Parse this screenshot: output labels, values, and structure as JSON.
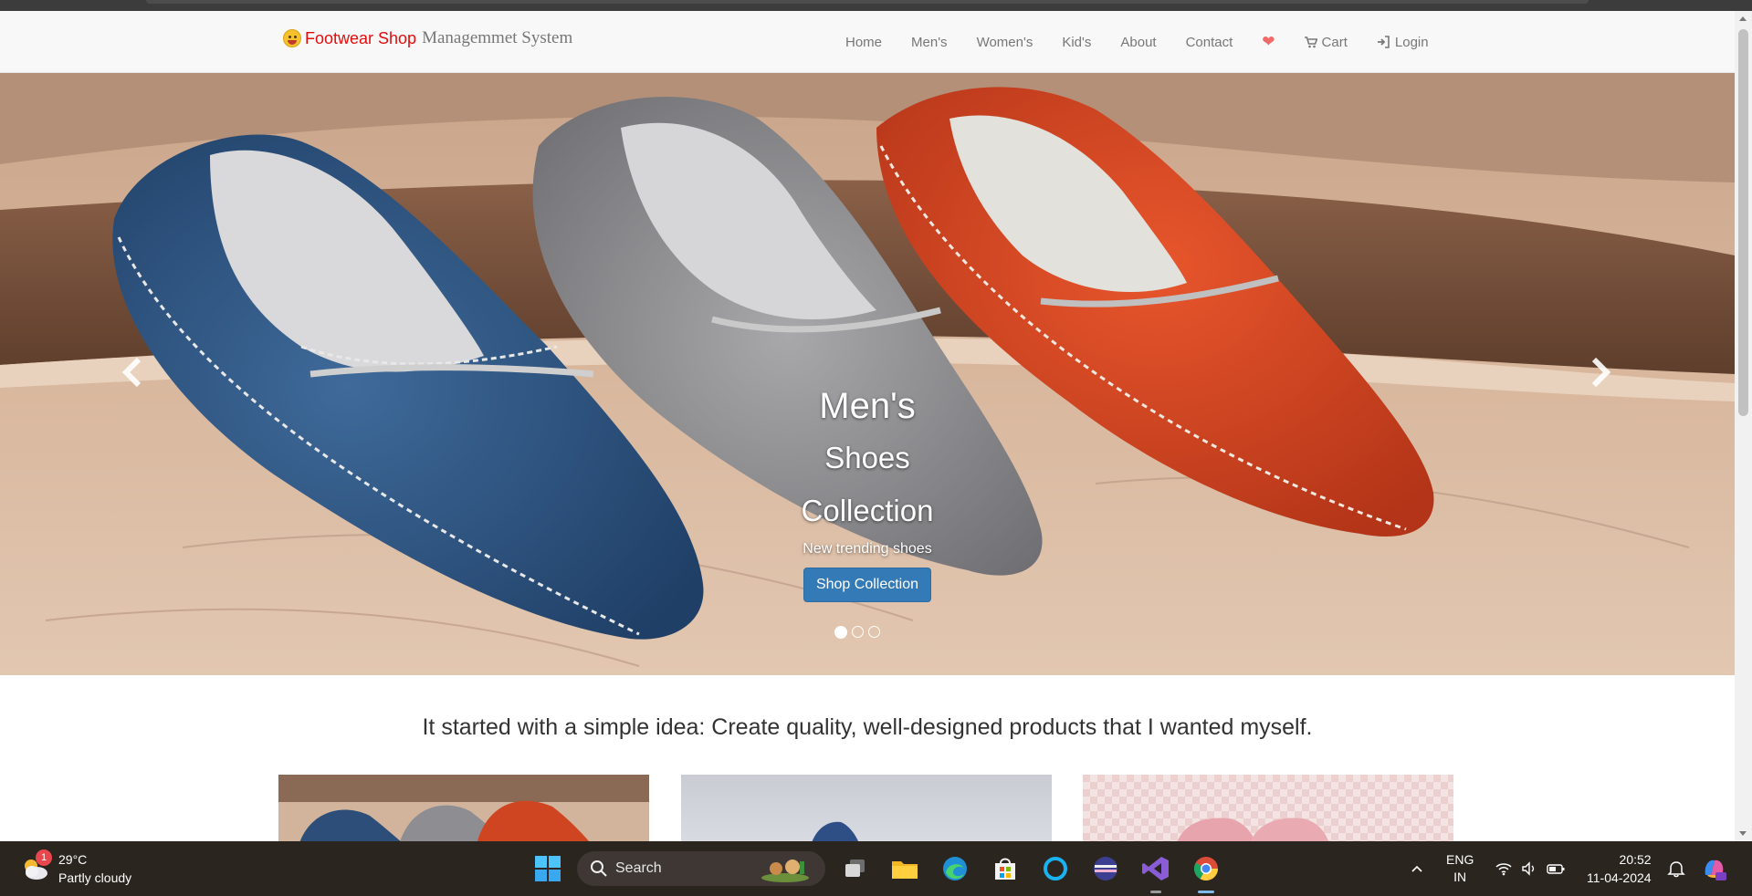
{
  "brand": {
    "name_red": "Footwear Shop",
    "name_gray": "Managemmet System"
  },
  "nav": {
    "items": [
      {
        "label": "Home"
      },
      {
        "label": "Men's"
      },
      {
        "label": "Women's"
      },
      {
        "label": "Kid's"
      },
      {
        "label": "About"
      },
      {
        "label": "Contact"
      }
    ],
    "wishlist_icon": "heart-icon",
    "cart_label": "Cart",
    "login_label": "Login"
  },
  "carousel": {
    "caption_line1": "Men's",
    "caption_line2": "Shoes",
    "caption_line3": "Collection",
    "subtitle": "New trending shoes",
    "button_label": "Shop Collection",
    "slide_count": 3,
    "active_slide": 1
  },
  "tagline": "It started with a simple idea: Create quality, well-designed products that I wanted myself.",
  "taskbar": {
    "weather": {
      "temp": "29°C",
      "condition": "Partly cloudy",
      "badge": "1"
    },
    "search_label": "Search",
    "lang_line1": "ENG",
    "lang_line2": "IN",
    "time": "20:52",
    "date": "11-04-2024"
  },
  "colors": {
    "brand_red": "#e30d0d",
    "primary_button": "#337ab7",
    "taskbar_bg": "#2b2520"
  }
}
